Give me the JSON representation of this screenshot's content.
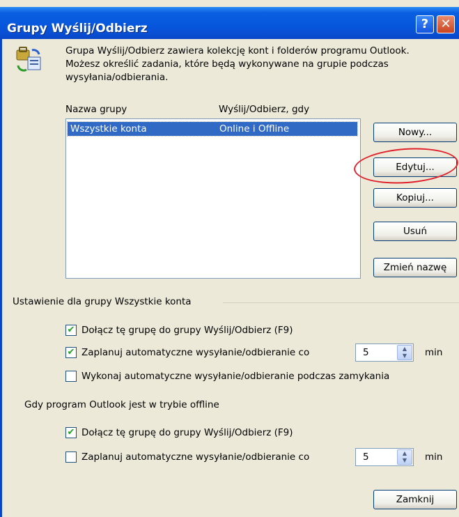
{
  "window": {
    "title": "Grupy Wyślij/Odbierz",
    "help_label": "?",
    "close_label": "✕"
  },
  "intro": {
    "lines": [
      "Grupa Wyślij/Odbierz zawiera kolekcję kont i folderów programu Outlook.",
      "Możesz określić zadania, które będą wykonywane na grupie podczas",
      "wysyłania/odbierania."
    ]
  },
  "list": {
    "headers": [
      "Nazwa grupy",
      "Wyślij/Odbierz, gdy"
    ],
    "rows": [
      {
        "name": "Wszystkie konta",
        "when": "Online i Offline"
      }
    ]
  },
  "buttons": {
    "new": "Nowy...",
    "edit": "Edytuj...",
    "copy": "Kopiuj...",
    "delete": "Usuń",
    "rename": "Zmień nazwę",
    "close": "Zamknij"
  },
  "settings": {
    "title": "Ustawienie dla grupy Wszystkie konta",
    "online": {
      "include_label": "Dołącz tę grupę do grupy Wyślij/Odbierz (F9)",
      "include_checked": true,
      "schedule_label": "Zaplanuj automatyczne wysyłanie/odbieranie co",
      "schedule_checked": true,
      "schedule_value": "5",
      "schedule_unit": "min",
      "on_exit_label": "Wykonaj automatyczne wysyłanie/odbieranie podczas zamykania",
      "on_exit_checked": false
    },
    "offline_title": "Gdy program Outlook jest w trybie offline",
    "offline": {
      "include_label": "Dołącz tę grupę do grupy Wyślij/Odbierz (F9)",
      "include_checked": true,
      "schedule_label": "Zaplanuj automatyczne wysyłanie/odbieranie co",
      "schedule_checked": false,
      "schedule_value": "5",
      "schedule_unit": "min"
    }
  },
  "check_glyph": "✔"
}
